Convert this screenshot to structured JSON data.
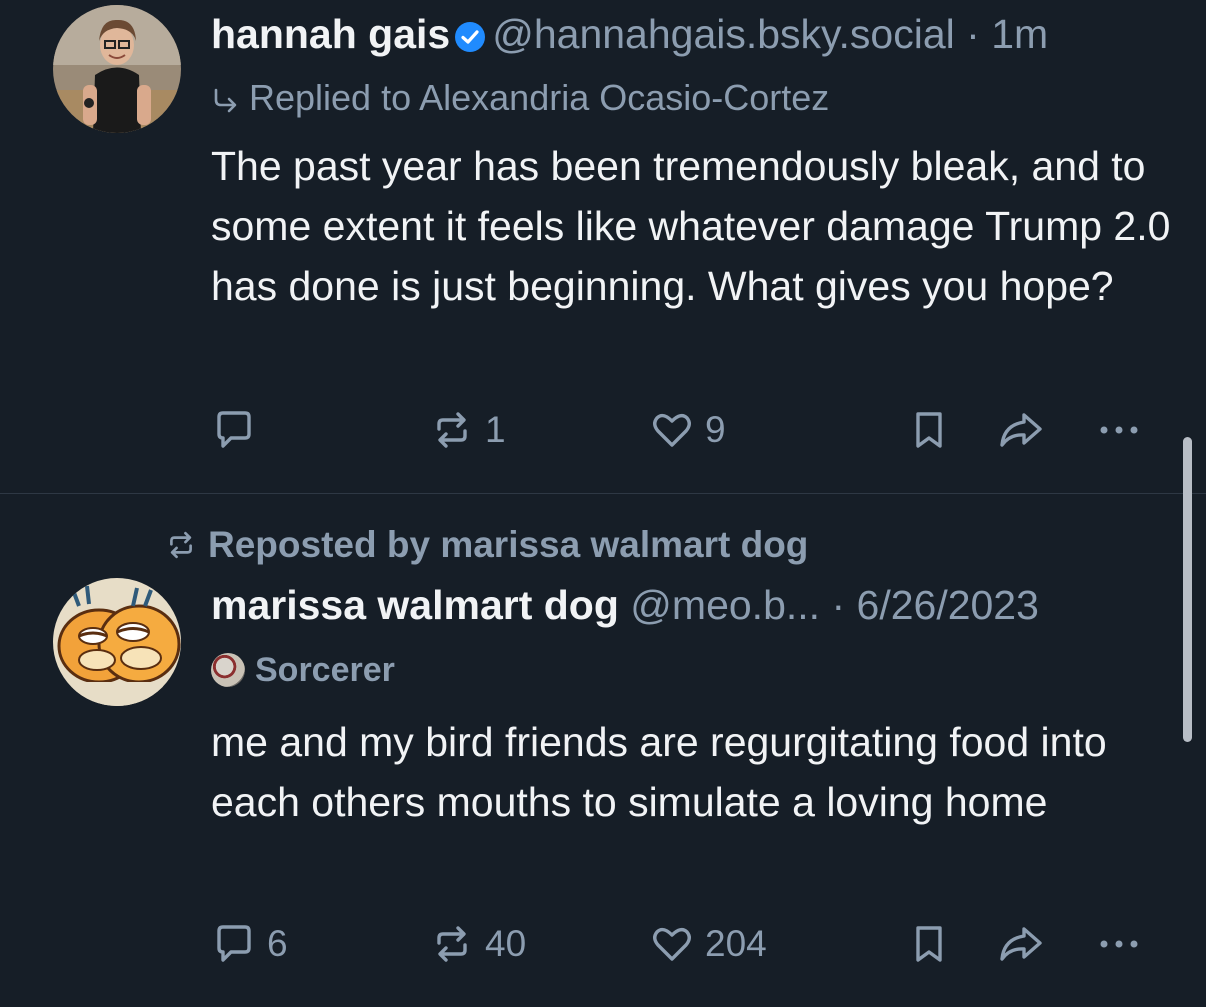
{
  "colors": {
    "background": "#161e27",
    "text_primary": "#f1f3f5",
    "text_secondary": "#8c9db0",
    "verified_badge": "#208bfe"
  },
  "posts": [
    {
      "display_name": "hannah gais",
      "verified": true,
      "handle": "@hannahgais.bsky.social",
      "separator": "·",
      "time": "1m",
      "reply_context": "Replied to Alexandria Ocasio-Cortez",
      "reply_icon": "reply-arrow-icon",
      "text": "The past year has been tremendously bleak, and to some extent it feels like whatever damage Trump 2.0 has done is just beginning. What gives you hope?",
      "actions": {
        "reply_count": "",
        "repost_count": "1",
        "like_count": "9"
      }
    },
    {
      "repost_label": "Reposted by marissa walmart dog",
      "display_name": "marissa walmart dog",
      "handle": "@meo.b...",
      "separator": "·",
      "time": "6/26/2023",
      "badge_label": "Sorcerer",
      "text": "me and my bird friends are regurgitating food into each others mouths to simulate a loving home",
      "actions": {
        "reply_count": "6",
        "repost_count": "40",
        "like_count": "204"
      }
    }
  ]
}
